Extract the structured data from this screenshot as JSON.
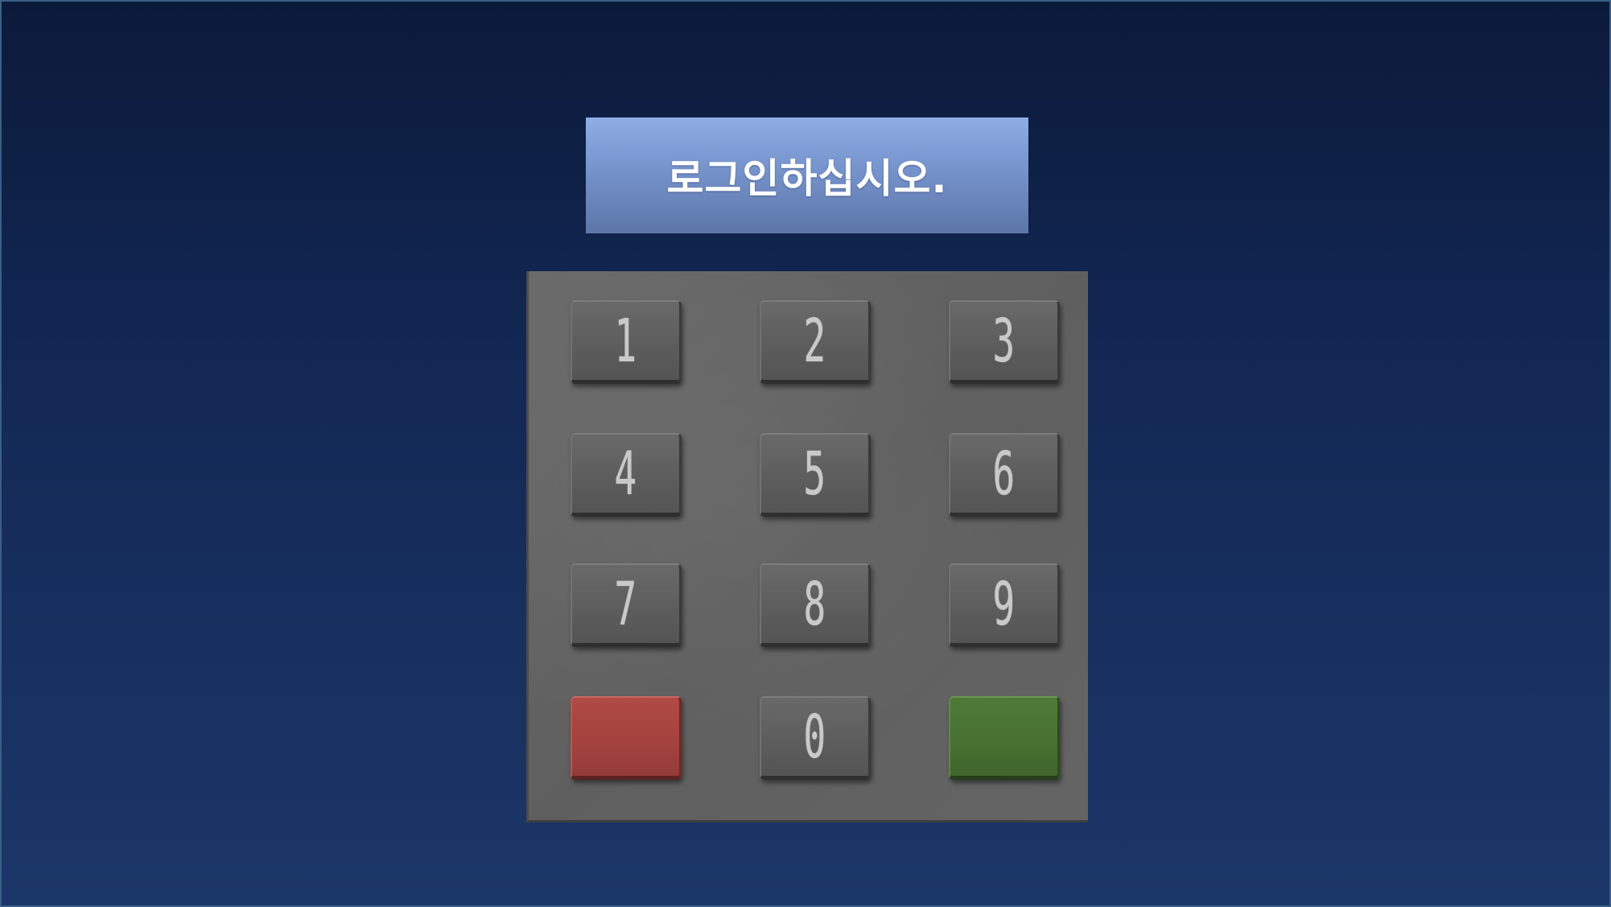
{
  "prompt": {
    "text": "로그인하십시오."
  },
  "keypad": {
    "keys": [
      {
        "label": "1"
      },
      {
        "label": "2"
      },
      {
        "label": "3"
      },
      {
        "label": "4"
      },
      {
        "label": "5"
      },
      {
        "label": "6"
      },
      {
        "label": "7"
      },
      {
        "label": "8"
      },
      {
        "label": "9"
      },
      {
        "label": ""
      },
      {
        "label": "0"
      },
      {
        "label": ""
      }
    ],
    "colors": {
      "cancel_key": "#a3423f",
      "enter_key": "#477031",
      "digit_key": "#5c5c5c",
      "panel": "#646464",
      "banner": "#7693cc"
    }
  }
}
